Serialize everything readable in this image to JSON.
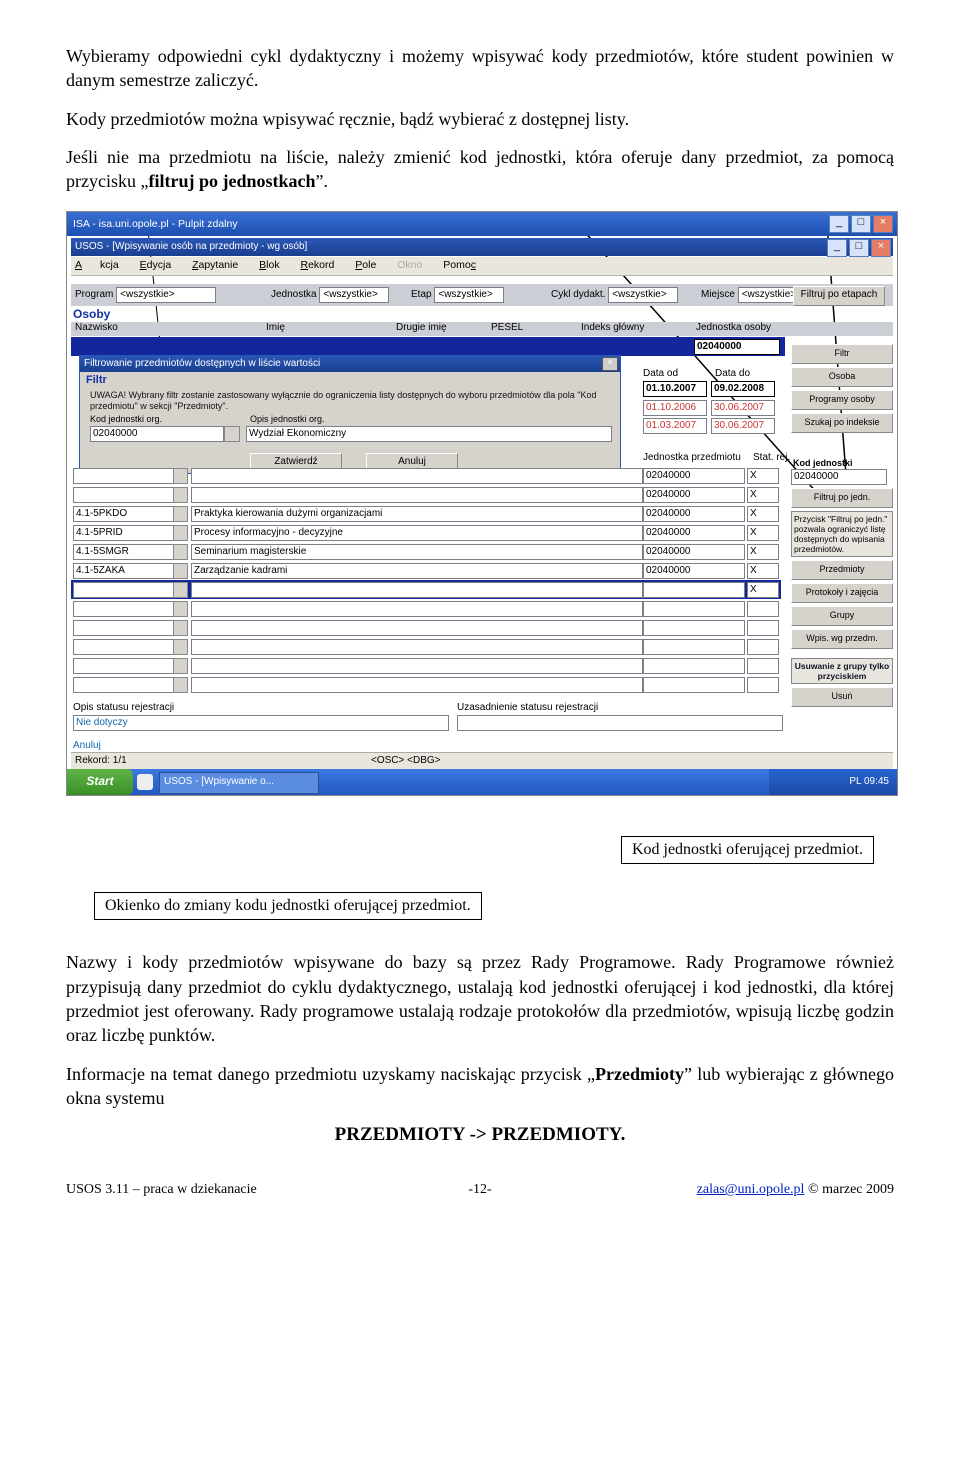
{
  "para1_a": "Wybieramy odpowiedni cykl dydaktyczny i możemy wpisywać kody przedmiotów, które student powinien w danym semestrze zaliczyć.",
  "para2": "Kody przedmiotów można wpisywać ręcznie, bądź wybierać z dostępnej listy.",
  "para3_a": "Jeśli nie ma przedmiotu na liście, należy zmienić kod jednostki, która oferuje dany przedmiot, za pomocą przycisku „",
  "para3_b": "filtruj po jednostkach",
  "para3_c": "”.",
  "annot_right": "Kod jednostki oferującej przedmiot.",
  "annot_left": "Okienko do zmiany kodu jednostki oferującej przedmiot.",
  "para4_a": "Nazwy i kody przedmiotów wpisywane do bazy są przez Rady Programowe. Rady Programowe również przypisują dany przedmiot do cyklu dydaktycznego, ustalają kod jednostki oferującej i kod jednostki, dla której przedmiot jest oferowany. Rady programowe ustalają rodzaje protokołów dla przedmiotów, wpisują liczbę godzin oraz liczbę punktów.",
  "para5_a": "Informacje na temat danego przedmiotu uzyskamy naciskając przycisk „",
  "para5_b": "Przedmioty",
  "para5_c": "” lub wybierając z głównego okna systemu",
  "heading": "PRZEDMIOTY -> PRZEDMIOTY.",
  "footer": {
    "left": "USOS 3.11 – praca w dziekanacie",
    "center": "-12-",
    "right_link": "zalas@uni.opole.pl",
    "right_txt": " © marzec 2009"
  },
  "rdp_title": "ISA - isa.uni.opole.pl - Pulpit zdalny",
  "usos_title": "USOS - [Wpisywanie osób na przedmioty - wg osób]",
  "menu": {
    "m1": "Akcja",
    "m2": "Edycja",
    "m3": "Zapytanie",
    "m4": "Blok",
    "m5": "Rekord",
    "m6": "Pole",
    "m7": "Okno",
    "m8": "Pomoc"
  },
  "fb": {
    "program": "Program",
    "jedn": "Jednostka",
    "etap": "Etap",
    "cykl": "Cykl dydakt.",
    "miejsce": "Miejsce",
    "wsz": "<wszystkie>"
  },
  "btn_etapy": "Filtruj po etapach",
  "osoby": "Osoby",
  "h1": {
    "nazw": "Nazwisko",
    "imie": "Imię",
    "drugie": "Drugie imię",
    "pesel": "PESEL",
    "index": "Indeks główny",
    "jedn": "Jednostka osoby"
  },
  "jedn_osoby": "02040000",
  "popup": {
    "title": "Filtrowanie przedmiotów dostępnych w liście wartości",
    "filtr": "Filtr",
    "warn": "UWAGA! Wybrany filtr zostanie zastosowany wyłącznie do ograniczenia listy dostępnych do wyboru przedmiotów dla pola \"Kod przedmiotu\" w sekcji \"Przedmioty\".",
    "lab1": "Kod jednostki org.",
    "lab2": "Opis jednostki org.",
    "v1": "02040000",
    "v2": "Wydział Ekonomiczny",
    "b1": "Zatwierdź",
    "b2": "Anuluj"
  },
  "dates": {
    "lab_od": "Data od",
    "lab_do": "Data do",
    "r1a": "01.10.2007",
    "r1b": "09.02.2008",
    "r2a": "01.10.2006",
    "r2b": "30.06.2007",
    "r3a": "01.03.2007",
    "r3b": "30.06.2007"
  },
  "sp": {
    "filtr": "Filtr",
    "osoba": "Osoba",
    "prog": "Programy osoby",
    "szukaj": "Szukaj po indeksie",
    "kodjed": "Kod jednostki",
    "kodjed_v": "02040000",
    "filtrujpo": "Filtruj po jedn.",
    "tip": "Przycisk \"Filtruj po jedn.\" pozwala ograniczyć listę dostępnych do wpisania przedmiotów.",
    "przed": "Przedmioty",
    "proto": "Protokoły i zajęcia",
    "grupy": "Grupy",
    "wgpr": "Wpis. wg przedm.",
    "usuw": "Usuwanie z grupy tylko przyciskiem",
    "usun": "Usuń"
  },
  "przh": {
    "jp": "Jednostka przedmiotu",
    "sr": "Stat. rej."
  },
  "prz_rows": [
    {
      "kod": "",
      "opis": "",
      "jp": "02040000",
      "st": "X"
    },
    {
      "kod": "",
      "opis": "",
      "jp": "02040000",
      "st": "X"
    },
    {
      "kod": "4.1-5PKDO",
      "opis": "Praktyka kierowania dużymi organizacjami",
      "jp": "02040000",
      "st": "X"
    },
    {
      "kod": "4.1-5PRID",
      "opis": "Procesy informacyjno - decyzyjne",
      "jp": "02040000",
      "st": "X"
    },
    {
      "kod": "4.1-5SMGR",
      "opis": "Seminarium magisterskie",
      "jp": "02040000",
      "st": "X"
    },
    {
      "kod": "4.1-5ZAKA",
      "opis": "Zarządzanie kadrami",
      "jp": "02040000",
      "st": "X"
    },
    {
      "kod": "",
      "opis": "",
      "jp": "",
      "st": "X",
      "hi": true
    }
  ],
  "opis_stat": "Opis statusu rejestracji",
  "uzas": "Uzasadnienie statusu rejestracji",
  "nie_dot": "Nie dotyczy",
  "anuluj": "Anuluj",
  "rekord": "Rekord: 1/1",
  "osc": "<OSC> <DBG>",
  "start": "Start",
  "task": "USOS - [Wpisywanie o...",
  "tray": "PL   09:45"
}
